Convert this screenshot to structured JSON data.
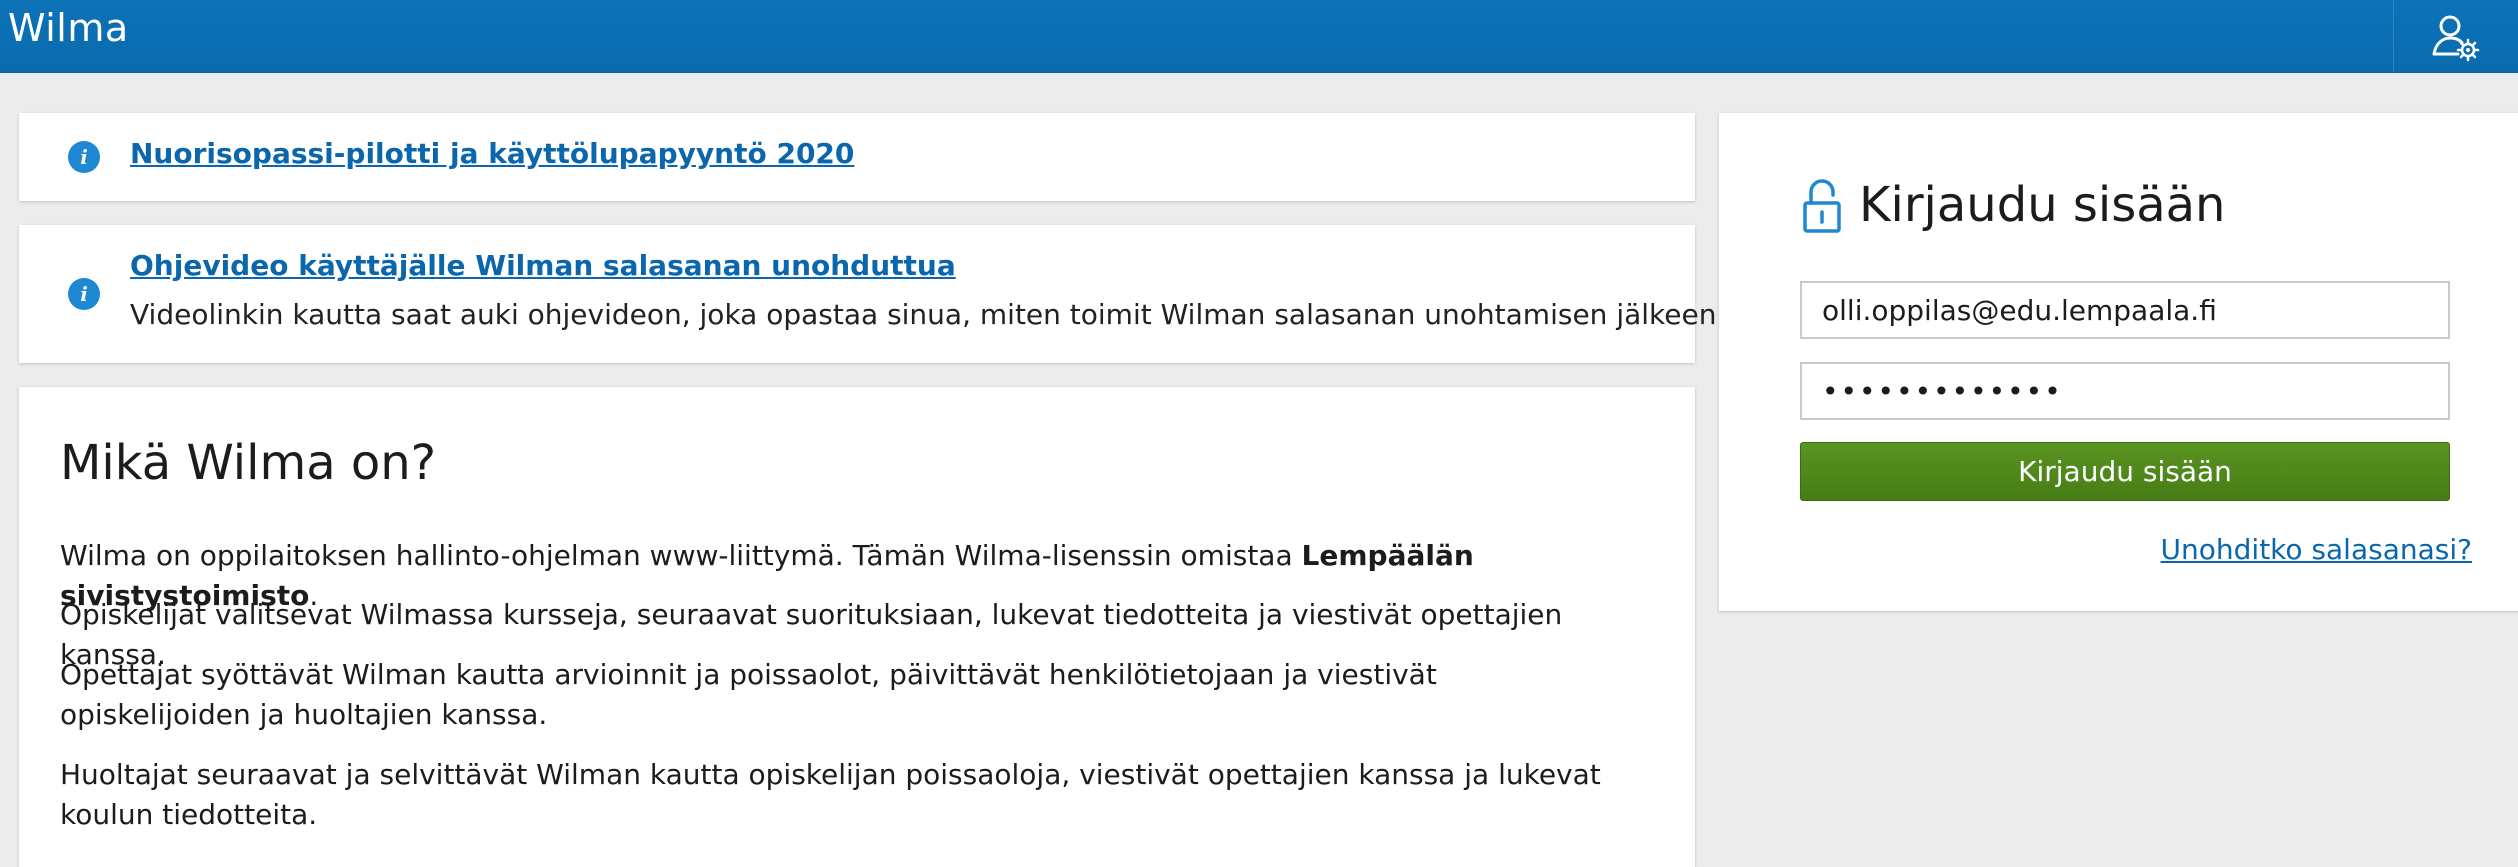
{
  "header": {
    "app_title": "Wilma",
    "user_icon": "user-settings-icon"
  },
  "notices": [
    {
      "icon": "info-icon",
      "link_text": "Nuorisopassi-pilotti ja käyttölupapyyntö 2020"
    },
    {
      "icon": "info-icon",
      "link_text": "Ohjevideo käyttäjälle Wilman salasanan unohduttua",
      "description": "Videolinkin kautta saat auki ohjevideon, joka opastaa sinua, miten toimit Wilman salasanan unohtamisen jälkeen."
    }
  ],
  "about": {
    "heading": "Mikä Wilma on?",
    "p1_before": "Wilma on oppilaitoksen hallinto-ohjelman www-liittymä. Tämän Wilma-lisenssin omistaa ",
    "p1_owner": "Lempäälän sivistystoimisto",
    "p1_after": ".",
    "p2": "Opiskelijat valitsevat Wilmassa kursseja, seuraavat suorituksiaan, lukevat tiedotteita ja viestivät opettajien kanssa.",
    "p3": "Opettajat syöttävät Wilman kautta arvioinnit ja poissaolot, päivittävät henkilötietojaan ja viestivät opiskelijoiden ja huoltajien kanssa.",
    "p4": "Huoltajat seuraavat ja selvittävät Wilman kautta opiskelijan poissaoloja, viestivät opettajien kanssa ja lukevat koulun tiedotteita."
  },
  "login": {
    "icon": "unlocked-padlock-icon",
    "title": "Kirjaudu sisään",
    "username_value": "olli.oppilas@edu.lempaala.fi",
    "password_value": "•••••••••••••",
    "submit_label": "Kirjaudu sisään",
    "forgot_link": "Unohditko salasanasi?"
  },
  "colors": {
    "header_blue": "#0d72b8",
    "link_blue": "#0b67ad",
    "button_green": "#4f8a1b",
    "page_background": "#ececec"
  }
}
